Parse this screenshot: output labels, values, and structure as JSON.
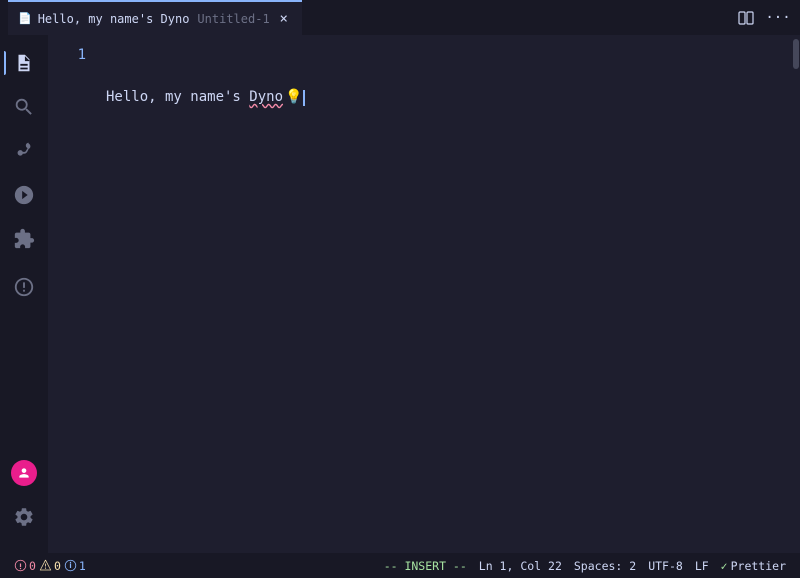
{
  "titleBar": {
    "tab": {
      "icon": "📄",
      "filename": "Hello, my name's Dyno",
      "subtitle": "Untitled-1",
      "closeLabel": "×"
    },
    "splitEditorBtn": "⊟",
    "moreActionsBtn": "⋯"
  },
  "activityBar": {
    "icons": [
      {
        "name": "explorer-icon",
        "symbol": "⧉",
        "active": true
      },
      {
        "name": "search-icon",
        "symbol": "🔍"
      },
      {
        "name": "source-control-icon",
        "symbol": "⎇"
      },
      {
        "name": "run-debug-icon",
        "symbol": "▶"
      },
      {
        "name": "extensions-icon",
        "symbol": "⊞"
      },
      {
        "name": "copilot-icon",
        "symbol": "◆"
      }
    ],
    "bottomIcons": [
      {
        "name": "account-icon",
        "type": "avatar"
      },
      {
        "name": "settings-icon",
        "symbol": "⚙"
      }
    ]
  },
  "editor": {
    "lineNumbers": [
      "1"
    ],
    "lines": [
      {
        "text": "Hello, my name's Dyno",
        "squigglyStart": 17,
        "squigglyEnd": 21,
        "hasBulb": true
      }
    ]
  },
  "statusBar": {
    "errors": "0",
    "warnings": "0",
    "infos": "1",
    "mode": "-- INSERT --",
    "position": "Ln 1, Col 22",
    "spaces": "Spaces: 2",
    "encoding": "UTF-8",
    "lineEnding": "LF",
    "prettier": "✓ Prettier"
  }
}
